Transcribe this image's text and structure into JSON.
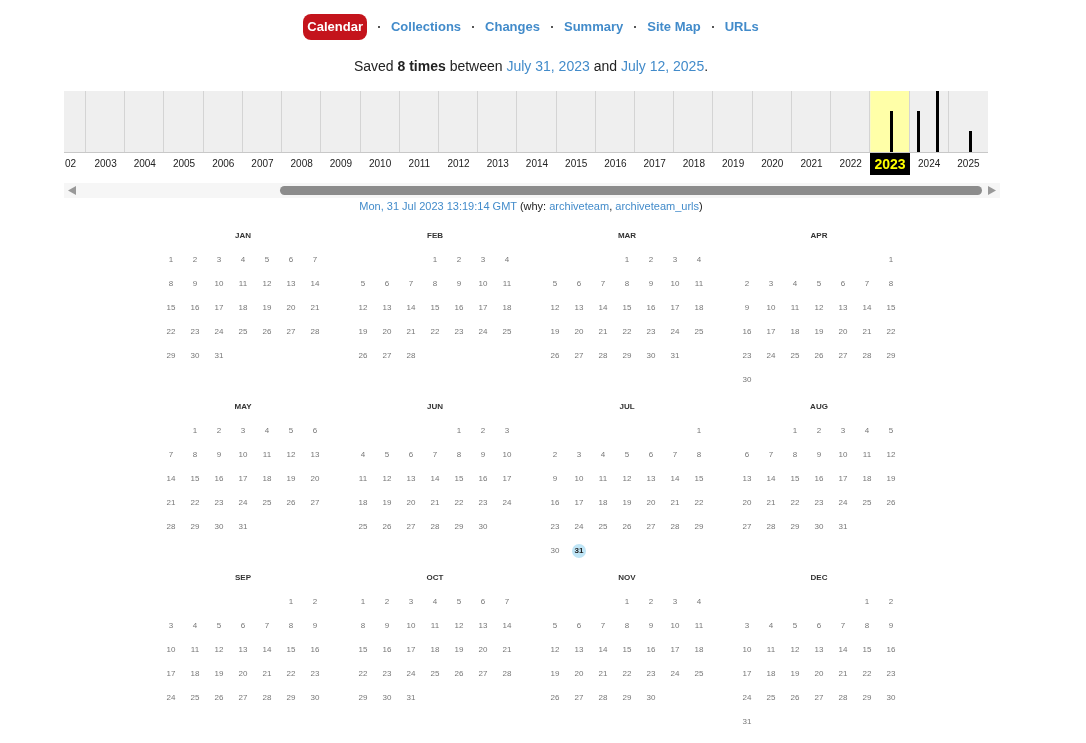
{
  "nav": [
    {
      "label": "Calendar",
      "selected": true
    },
    {
      "label": "Collections",
      "selected": false
    },
    {
      "label": "Changes",
      "selected": false
    },
    {
      "label": "Summary",
      "selected": false
    },
    {
      "label": "Site Map",
      "selected": false
    },
    {
      "label": "URLs",
      "selected": false
    }
  ],
  "summary": [
    {
      "kind": "text",
      "text": "Saved **8 times** between "
    },
    {
      "kind": "link",
      "text": "July 31, 2023"
    },
    {
      "kind": "text",
      "text": " and "
    },
    {
      "kind": "link",
      "text": "July 12, 2025"
    },
    {
      "kind": "text",
      "text": "."
    }
  ],
  "timeline": {
    "years": [
      {
        "label": "02",
        "selected": false
      },
      {
        "label": "2003",
        "selected": false
      },
      {
        "label": "2004",
        "selected": false
      },
      {
        "label": "2005",
        "selected": false
      },
      {
        "label": "2006",
        "selected": false
      },
      {
        "label": "2007",
        "selected": false
      },
      {
        "label": "2008",
        "selected": false
      },
      {
        "label": "2009",
        "selected": false
      },
      {
        "label": "2010",
        "selected": false
      },
      {
        "label": "2011",
        "selected": false
      },
      {
        "label": "2012",
        "selected": false
      },
      {
        "label": "2013",
        "selected": false
      },
      {
        "label": "2014",
        "selected": false
      },
      {
        "label": "2015",
        "selected": false
      },
      {
        "label": "2016",
        "selected": false
      },
      {
        "label": "2017",
        "selected": false
      },
      {
        "label": "2018",
        "selected": false
      },
      {
        "label": "2019",
        "selected": false
      },
      {
        "label": "2020",
        "selected": false
      },
      {
        "label": "2021",
        "selected": false
      },
      {
        "label": "2022",
        "selected": false
      },
      {
        "label": "2023",
        "selected": true
      },
      {
        "label": "2024",
        "selected": false
      },
      {
        "label": "2025",
        "selected": false
      }
    ]
  },
  "capture": [
    {
      "kind": "link",
      "text": "Mon, 31 Jul 2023 13:19:14 GMT"
    },
    {
      "kind": "text",
      "text": " (why: "
    },
    {
      "kind": "link",
      "text": "archiveteam"
    },
    {
      "kind": "text",
      "text": ", "
    },
    {
      "kind": "link",
      "text": "archiveteam_urls"
    },
    {
      "kind": "text",
      "text": ")"
    }
  ],
  "calendar": {
    "months": [
      {
        "name": "JAN",
        "weeks": [
          [
            {
              "day": "1",
              "captured": false
            },
            {
              "day": "2",
              "captured": false
            },
            {
              "day": "3",
              "captured": false
            },
            {
              "day": "4",
              "captured": false
            },
            {
              "day": "5",
              "captured": false
            },
            {
              "day": "6",
              "captured": false
            },
            {
              "day": "7",
              "captured": false
            }
          ],
          [
            {
              "day": "8",
              "captured": false
            },
            {
              "day": "9",
              "captured": false
            },
            {
              "day": "10",
              "captured": false
            },
            {
              "day": "11",
              "captured": false
            },
            {
              "day": "12",
              "captured": false
            },
            {
              "day": "13",
              "captured": false
            },
            {
              "day": "14",
              "captured": false
            }
          ],
          [
            {
              "day": "15",
              "captured": false
            },
            {
              "day": "16",
              "captured": false
            },
            {
              "day": "17",
              "captured": false
            },
            {
              "day": "18",
              "captured": false
            },
            {
              "day": "19",
              "captured": false
            },
            {
              "day": "20",
              "captured": false
            },
            {
              "day": "21",
              "captured": false
            }
          ],
          [
            {
              "day": "22",
              "captured": false
            },
            {
              "day": "23",
              "captured": false
            },
            {
              "day": "24",
              "captured": false
            },
            {
              "day": "25",
              "captured": false
            },
            {
              "day": "26",
              "captured": false
            },
            {
              "day": "27",
              "captured": false
            },
            {
              "day": "28",
              "captured": false
            }
          ],
          [
            {
              "day": "29",
              "captured": false
            },
            {
              "day": "30",
              "captured": false
            },
            {
              "day": "31",
              "captured": false
            }
          ]
        ]
      },
      {
        "name": "FEB",
        "weeks": [
          [
            {
              "day": "1",
              "captured": false
            },
            {
              "day": "2",
              "captured": false
            },
            {
              "day": "3",
              "captured": false
            },
            {
              "day": "4",
              "captured": false
            }
          ],
          [
            {
              "day": "5",
              "captured": false
            },
            {
              "day": "6",
              "captured": false
            },
            {
              "day": "7",
              "captured": false
            },
            {
              "day": "8",
              "captured": false
            },
            {
              "day": "9",
              "captured": false
            },
            {
              "day": "10",
              "captured": false
            },
            {
              "day": "11",
              "captured": false
            }
          ],
          [
            {
              "day": "12",
              "captured": false
            },
            {
              "day": "13",
              "captured": false
            },
            {
              "day": "14",
              "captured": false
            },
            {
              "day": "15",
              "captured": false
            },
            {
              "day": "16",
              "captured": false
            },
            {
              "day": "17",
              "captured": false
            },
            {
              "day": "18",
              "captured": false
            }
          ],
          [
            {
              "day": "19",
              "captured": false
            },
            {
              "day": "20",
              "captured": false
            },
            {
              "day": "21",
              "captured": false
            },
            {
              "day": "22",
              "captured": false
            },
            {
              "day": "23",
              "captured": false
            },
            {
              "day": "24",
              "captured": false
            },
            {
              "day": "25",
              "captured": false
            }
          ],
          [
            {
              "day": "26",
              "captured": false
            },
            {
              "day": "27",
              "captured": false
            },
            {
              "day": "28",
              "captured": false
            }
          ]
        ]
      },
      {
        "name": "MAR",
        "weeks": [
          [
            {
              "day": "1",
              "captured": false
            },
            {
              "day": "2",
              "captured": false
            },
            {
              "day": "3",
              "captured": false
            },
            {
              "day": "4",
              "captured": false
            }
          ],
          [
            {
              "day": "5",
              "captured": false
            },
            {
              "day": "6",
              "captured": false
            },
            {
              "day": "7",
              "captured": false
            },
            {
              "day": "8",
              "captured": false
            },
            {
              "day": "9",
              "captured": false
            },
            {
              "day": "10",
              "captured": false
            },
            {
              "day": "11",
              "captured": false
            }
          ],
          [
            {
              "day": "12",
              "captured": false
            },
            {
              "day": "13",
              "captured": false
            },
            {
              "day": "14",
              "captured": false
            },
            {
              "day": "15",
              "captured": false
            },
            {
              "day": "16",
              "captured": false
            },
            {
              "day": "17",
              "captured": false
            },
            {
              "day": "18",
              "captured": false
            }
          ],
          [
            {
              "day": "19",
              "captured": false
            },
            {
              "day": "20",
              "captured": false
            },
            {
              "day": "21",
              "captured": false
            },
            {
              "day": "22",
              "captured": false
            },
            {
              "day": "23",
              "captured": false
            },
            {
              "day": "24",
              "captured": false
            },
            {
              "day": "25",
              "captured": false
            }
          ],
          [
            {
              "day": "26",
              "captured": false
            },
            {
              "day": "27",
              "captured": false
            },
            {
              "day": "28",
              "captured": false
            },
            {
              "day": "29",
              "captured": false
            },
            {
              "day": "30",
              "captured": false
            },
            {
              "day": "31",
              "captured": false
            }
          ]
        ]
      },
      {
        "name": "APR",
        "weeks": [
          [
            {
              "day": "1",
              "captured": false
            }
          ],
          [
            {
              "day": "2",
              "captured": false
            },
            {
              "day": "3",
              "captured": false
            },
            {
              "day": "4",
              "captured": false
            },
            {
              "day": "5",
              "captured": false
            },
            {
              "day": "6",
              "captured": false
            },
            {
              "day": "7",
              "captured": false
            },
            {
              "day": "8",
              "captured": false
            }
          ],
          [
            {
              "day": "9",
              "captured": false
            },
            {
              "day": "10",
              "captured": false
            },
            {
              "day": "11",
              "captured": false
            },
            {
              "day": "12",
              "captured": false
            },
            {
              "day": "13",
              "captured": false
            },
            {
              "day": "14",
              "captured": false
            },
            {
              "day": "15",
              "captured": false
            }
          ],
          [
            {
              "day": "16",
              "captured": false
            },
            {
              "day": "17",
              "captured": false
            },
            {
              "day": "18",
              "captured": false
            },
            {
              "day": "19",
              "captured": false
            },
            {
              "day": "20",
              "captured": false
            },
            {
              "day": "21",
              "captured": false
            },
            {
              "day": "22",
              "captured": false
            }
          ],
          [
            {
              "day": "23",
              "captured": false
            },
            {
              "day": "24",
              "captured": false
            },
            {
              "day": "25",
              "captured": false
            },
            {
              "day": "26",
              "captured": false
            },
            {
              "day": "27",
              "captured": false
            },
            {
              "day": "28",
              "captured": false
            },
            {
              "day": "29",
              "captured": false
            }
          ],
          [
            {
              "day": "30",
              "captured": false
            }
          ]
        ]
      },
      {
        "name": "MAY",
        "weeks": [
          [
            {
              "day": "1",
              "captured": false
            },
            {
              "day": "2",
              "captured": false
            },
            {
              "day": "3",
              "captured": false
            },
            {
              "day": "4",
              "captured": false
            },
            {
              "day": "5",
              "captured": false
            },
            {
              "day": "6",
              "captured": false
            }
          ],
          [
            {
              "day": "7",
              "captured": false
            },
            {
              "day": "8",
              "captured": false
            },
            {
              "day": "9",
              "captured": false
            },
            {
              "day": "10",
              "captured": false
            },
            {
              "day": "11",
              "captured": false
            },
            {
              "day": "12",
              "captured": false
            },
            {
              "day": "13",
              "captured": false
            }
          ],
          [
            {
              "day": "14",
              "captured": false
            },
            {
              "day": "15",
              "captured": false
            },
            {
              "day": "16",
              "captured": false
            },
            {
              "day": "17",
              "captured": false
            },
            {
              "day": "18",
              "captured": false
            },
            {
              "day": "19",
              "captured": false
            },
            {
              "day": "20",
              "captured": false
            }
          ],
          [
            {
              "day": "21",
              "captured": false
            },
            {
              "day": "22",
              "captured": false
            },
            {
              "day": "23",
              "captured": false
            },
            {
              "day": "24",
              "captured": false
            },
            {
              "day": "25",
              "captured": false
            },
            {
              "day": "26",
              "captured": false
            },
            {
              "day": "27",
              "captured": false
            }
          ],
          [
            {
              "day": "28",
              "captured": false
            },
            {
              "day": "29",
              "captured": false
            },
            {
              "day": "30",
              "captured": false
            },
            {
              "day": "31",
              "captured": false
            }
          ]
        ]
      },
      {
        "name": "JUN",
        "weeks": [
          [
            {
              "day": "1",
              "captured": false
            },
            {
              "day": "2",
              "captured": false
            },
            {
              "day": "3",
              "captured": false
            }
          ],
          [
            {
              "day": "4",
              "captured": false
            },
            {
              "day": "5",
              "captured": false
            },
            {
              "day": "6",
              "captured": false
            },
            {
              "day": "7",
              "captured": false
            },
            {
              "day": "8",
              "captured": false
            },
            {
              "day": "9",
              "captured": false
            },
            {
              "day": "10",
              "captured": false
            }
          ],
          [
            {
              "day": "11",
              "captured": false
            },
            {
              "day": "12",
              "captured": false
            },
            {
              "day": "13",
              "captured": false
            },
            {
              "day": "14",
              "captured": false
            },
            {
              "day": "15",
              "captured": false
            },
            {
              "day": "16",
              "captured": false
            },
            {
              "day": "17",
              "captured": false
            }
          ],
          [
            {
              "day": "18",
              "captured": false
            },
            {
              "day": "19",
              "captured": false
            },
            {
              "day": "20",
              "captured": false
            },
            {
              "day": "21",
              "captured": false
            },
            {
              "day": "22",
              "captured": false
            },
            {
              "day": "23",
              "captured": false
            },
            {
              "day": "24",
              "captured": false
            }
          ],
          [
            {
              "day": "25",
              "captured": false
            },
            {
              "day": "26",
              "captured": false
            },
            {
              "day": "27",
              "captured": false
            },
            {
              "day": "28",
              "captured": false
            },
            {
              "day": "29",
              "captured": false
            },
            {
              "day": "30",
              "captured": false
            }
          ]
        ]
      },
      {
        "name": "JUL",
        "weeks": [
          [
            {
              "day": "1",
              "captured": false
            }
          ],
          [
            {
              "day": "2",
              "captured": false
            },
            {
              "day": "3",
              "captured": false
            },
            {
              "day": "4",
              "captured": false
            },
            {
              "day": "5",
              "captured": false
            },
            {
              "day": "6",
              "captured": false
            },
            {
              "day": "7",
              "captured": false
            },
            {
              "day": "8",
              "captured": false
            }
          ],
          [
            {
              "day": "9",
              "captured": false
            },
            {
              "day": "10",
              "captured": false
            },
            {
              "day": "11",
              "captured": false
            },
            {
              "day": "12",
              "captured": false
            },
            {
              "day": "13",
              "captured": false
            },
            {
              "day": "14",
              "captured": false
            },
            {
              "day": "15",
              "captured": false
            }
          ],
          [
            {
              "day": "16",
              "captured": false
            },
            {
              "day": "17",
              "captured": false
            },
            {
              "day": "18",
              "captured": false
            },
            {
              "day": "19",
              "captured": false
            },
            {
              "day": "20",
              "captured": false
            },
            {
              "day": "21",
              "captured": false
            },
            {
              "day": "22",
              "captured": false
            }
          ],
          [
            {
              "day": "23",
              "captured": false
            },
            {
              "day": "24",
              "captured": false
            },
            {
              "day": "25",
              "captured": false
            },
            {
              "day": "26",
              "captured": false
            },
            {
              "day": "27",
              "captured": false
            },
            {
              "day": "28",
              "captured": false
            },
            {
              "day": "29",
              "captured": false
            }
          ],
          [
            {
              "day": "30",
              "captured": false
            },
            {
              "day": "31",
              "captured": true
            }
          ]
        ]
      },
      {
        "name": "AUG",
        "weeks": [
          [
            {
              "day": "1",
              "captured": false
            },
            {
              "day": "2",
              "captured": false
            },
            {
              "day": "3",
              "captured": false
            },
            {
              "day": "4",
              "captured": false
            },
            {
              "day": "5",
              "captured": false
            }
          ],
          [
            {
              "day": "6",
              "captured": false
            },
            {
              "day": "7",
              "captured": false
            },
            {
              "day": "8",
              "captured": false
            },
            {
              "day": "9",
              "captured": false
            },
            {
              "day": "10",
              "captured": false
            },
            {
              "day": "11",
              "captured": false
            },
            {
              "day": "12",
              "captured": false
            }
          ],
          [
            {
              "day": "13",
              "captured": false
            },
            {
              "day": "14",
              "captured": false
            },
            {
              "day": "15",
              "captured": false
            },
            {
              "day": "16",
              "captured": false
            },
            {
              "day": "17",
              "captured": false
            },
            {
              "day": "18",
              "captured": false
            },
            {
              "day": "19",
              "captured": false
            }
          ],
          [
            {
              "day": "20",
              "captured": false
            },
            {
              "day": "21",
              "captured": false
            },
            {
              "day": "22",
              "captured": false
            },
            {
              "day": "23",
              "captured": false
            },
            {
              "day": "24",
              "captured": false
            },
            {
              "day": "25",
              "captured": false
            },
            {
              "day": "26",
              "captured": false
            }
          ],
          [
            {
              "day": "27",
              "captured": false
            },
            {
              "day": "28",
              "captured": false
            },
            {
              "day": "29",
              "captured": false
            },
            {
              "day": "30",
              "captured": false
            },
            {
              "day": "31",
              "captured": false
            }
          ]
        ]
      },
      {
        "name": "SEP",
        "weeks": [
          [
            {
              "day": "1",
              "captured": false
            },
            {
              "day": "2",
              "captured": false
            }
          ],
          [
            {
              "day": "3",
              "captured": false
            },
            {
              "day": "4",
              "captured": false
            },
            {
              "day": "5",
              "captured": false
            },
            {
              "day": "6",
              "captured": false
            },
            {
              "day": "7",
              "captured": false
            },
            {
              "day": "8",
              "captured": false
            },
            {
              "day": "9",
              "captured": false
            }
          ],
          [
            {
              "day": "10",
              "captured": false
            },
            {
              "day": "11",
              "captured": false
            },
            {
              "day": "12",
              "captured": false
            },
            {
              "day": "13",
              "captured": false
            },
            {
              "day": "14",
              "captured": false
            },
            {
              "day": "15",
              "captured": false
            },
            {
              "day": "16",
              "captured": false
            }
          ],
          [
            {
              "day": "17",
              "captured": false
            },
            {
              "day": "18",
              "captured": false
            },
            {
              "day": "19",
              "captured": false
            },
            {
              "day": "20",
              "captured": false
            },
            {
              "day": "21",
              "captured": false
            },
            {
              "day": "22",
              "captured": false
            },
            {
              "day": "23",
              "captured": false
            }
          ],
          [
            {
              "day": "24",
              "captured": false
            },
            {
              "day": "25",
              "captured": false
            },
            {
              "day": "26",
              "captured": false
            },
            {
              "day": "27",
              "captured": false
            },
            {
              "day": "28",
              "captured": false
            },
            {
              "day": "29",
              "captured": false
            },
            {
              "day": "30",
              "captured": false
            }
          ]
        ]
      },
      {
        "name": "OCT",
        "weeks": [
          [
            {
              "day": "1",
              "captured": false
            },
            {
              "day": "2",
              "captured": false
            },
            {
              "day": "3",
              "captured": false
            },
            {
              "day": "4",
              "captured": false
            },
            {
              "day": "5",
              "captured": false
            },
            {
              "day": "6",
              "captured": false
            },
            {
              "day": "7",
              "captured": false
            }
          ],
          [
            {
              "day": "8",
              "captured": false
            },
            {
              "day": "9",
              "captured": false
            },
            {
              "day": "10",
              "captured": false
            },
            {
              "day": "11",
              "captured": false
            },
            {
              "day": "12",
              "captured": false
            },
            {
              "day": "13",
              "captured": false
            },
            {
              "day": "14",
              "captured": false
            }
          ],
          [
            {
              "day": "15",
              "captured": false
            },
            {
              "day": "16",
              "captured": false
            },
            {
              "day": "17",
              "captured": false
            },
            {
              "day": "18",
              "captured": false
            },
            {
              "day": "19",
              "captured": false
            },
            {
              "day": "20",
              "captured": false
            },
            {
              "day": "21",
              "captured": false
            }
          ],
          [
            {
              "day": "22",
              "captured": false
            },
            {
              "day": "23",
              "captured": false
            },
            {
              "day": "24",
              "captured": false
            },
            {
              "day": "25",
              "captured": false
            },
            {
              "day": "26",
              "captured": false
            },
            {
              "day": "27",
              "captured": false
            },
            {
              "day": "28",
              "captured": false
            }
          ],
          [
            {
              "day": "29",
              "captured": false
            },
            {
              "day": "30",
              "captured": false
            },
            {
              "day": "31",
              "captured": false
            }
          ]
        ]
      },
      {
        "name": "NOV",
        "weeks": [
          [
            {
              "day": "1",
              "captured": false
            },
            {
              "day": "2",
              "captured": false
            },
            {
              "day": "3",
              "captured": false
            },
            {
              "day": "4",
              "captured": false
            }
          ],
          [
            {
              "day": "5",
              "captured": false
            },
            {
              "day": "6",
              "captured": false
            },
            {
              "day": "7",
              "captured": false
            },
            {
              "day": "8",
              "captured": false
            },
            {
              "day": "9",
              "captured": false
            },
            {
              "day": "10",
              "captured": false
            },
            {
              "day": "11",
              "captured": false
            }
          ],
          [
            {
              "day": "12",
              "captured": false
            },
            {
              "day": "13",
              "captured": false
            },
            {
              "day": "14",
              "captured": false
            },
            {
              "day": "15",
              "captured": false
            },
            {
              "day": "16",
              "captured": false
            },
            {
              "day": "17",
              "captured": false
            },
            {
              "day": "18",
              "captured": false
            }
          ],
          [
            {
              "day": "19",
              "captured": false
            },
            {
              "day": "20",
              "captured": false
            },
            {
              "day": "21",
              "captured": false
            },
            {
              "day": "22",
              "captured": false
            },
            {
              "day": "23",
              "captured": false
            },
            {
              "day": "24",
              "captured": false
            },
            {
              "day": "25",
              "captured": false
            }
          ],
          [
            {
              "day": "26",
              "captured": false
            },
            {
              "day": "27",
              "captured": false
            },
            {
              "day": "28",
              "captured": false
            },
            {
              "day": "29",
              "captured": false
            },
            {
              "day": "30",
              "captured": false
            }
          ]
        ]
      },
      {
        "name": "DEC",
        "weeks": [
          [
            {
              "day": "1",
              "captured": false
            },
            {
              "day": "2",
              "captured": false
            }
          ],
          [
            {
              "day": "3",
              "captured": false
            },
            {
              "day": "4",
              "captured": false
            },
            {
              "day": "5",
              "captured": false
            },
            {
              "day": "6",
              "captured": false
            },
            {
              "day": "7",
              "captured": false
            },
            {
              "day": "8",
              "captured": false
            },
            {
              "day": "9",
              "captured": false
            }
          ],
          [
            {
              "day": "10",
              "captured": false
            },
            {
              "day": "11",
              "captured": false
            },
            {
              "day": "12",
              "captured": false
            },
            {
              "day": "13",
              "captured": false
            },
            {
              "day": "14",
              "captured": false
            },
            {
              "day": "15",
              "captured": false
            },
            {
              "day": "16",
              "captured": false
            }
          ],
          [
            {
              "day": "17",
              "captured": false
            },
            {
              "day": "18",
              "captured": false
            },
            {
              "day": "19",
              "captured": false
            },
            {
              "day": "20",
              "captured": false
            },
            {
              "day": "21",
              "captured": false
            },
            {
              "day": "22",
              "captured": false
            },
            {
              "day": "23",
              "captured": false
            }
          ],
          [
            {
              "day": "24",
              "captured": false
            },
            {
              "day": "25",
              "captured": false
            },
            {
              "day": "26",
              "captured": false
            },
            {
              "day": "27",
              "captured": false
            },
            {
              "day": "28",
              "captured": false
            },
            {
              "day": "29",
              "captured": false
            },
            {
              "day": "30",
              "captured": false
            }
          ],
          [
            {
              "day": "31",
              "captured": false
            }
          ]
        ]
      }
    ]
  }
}
